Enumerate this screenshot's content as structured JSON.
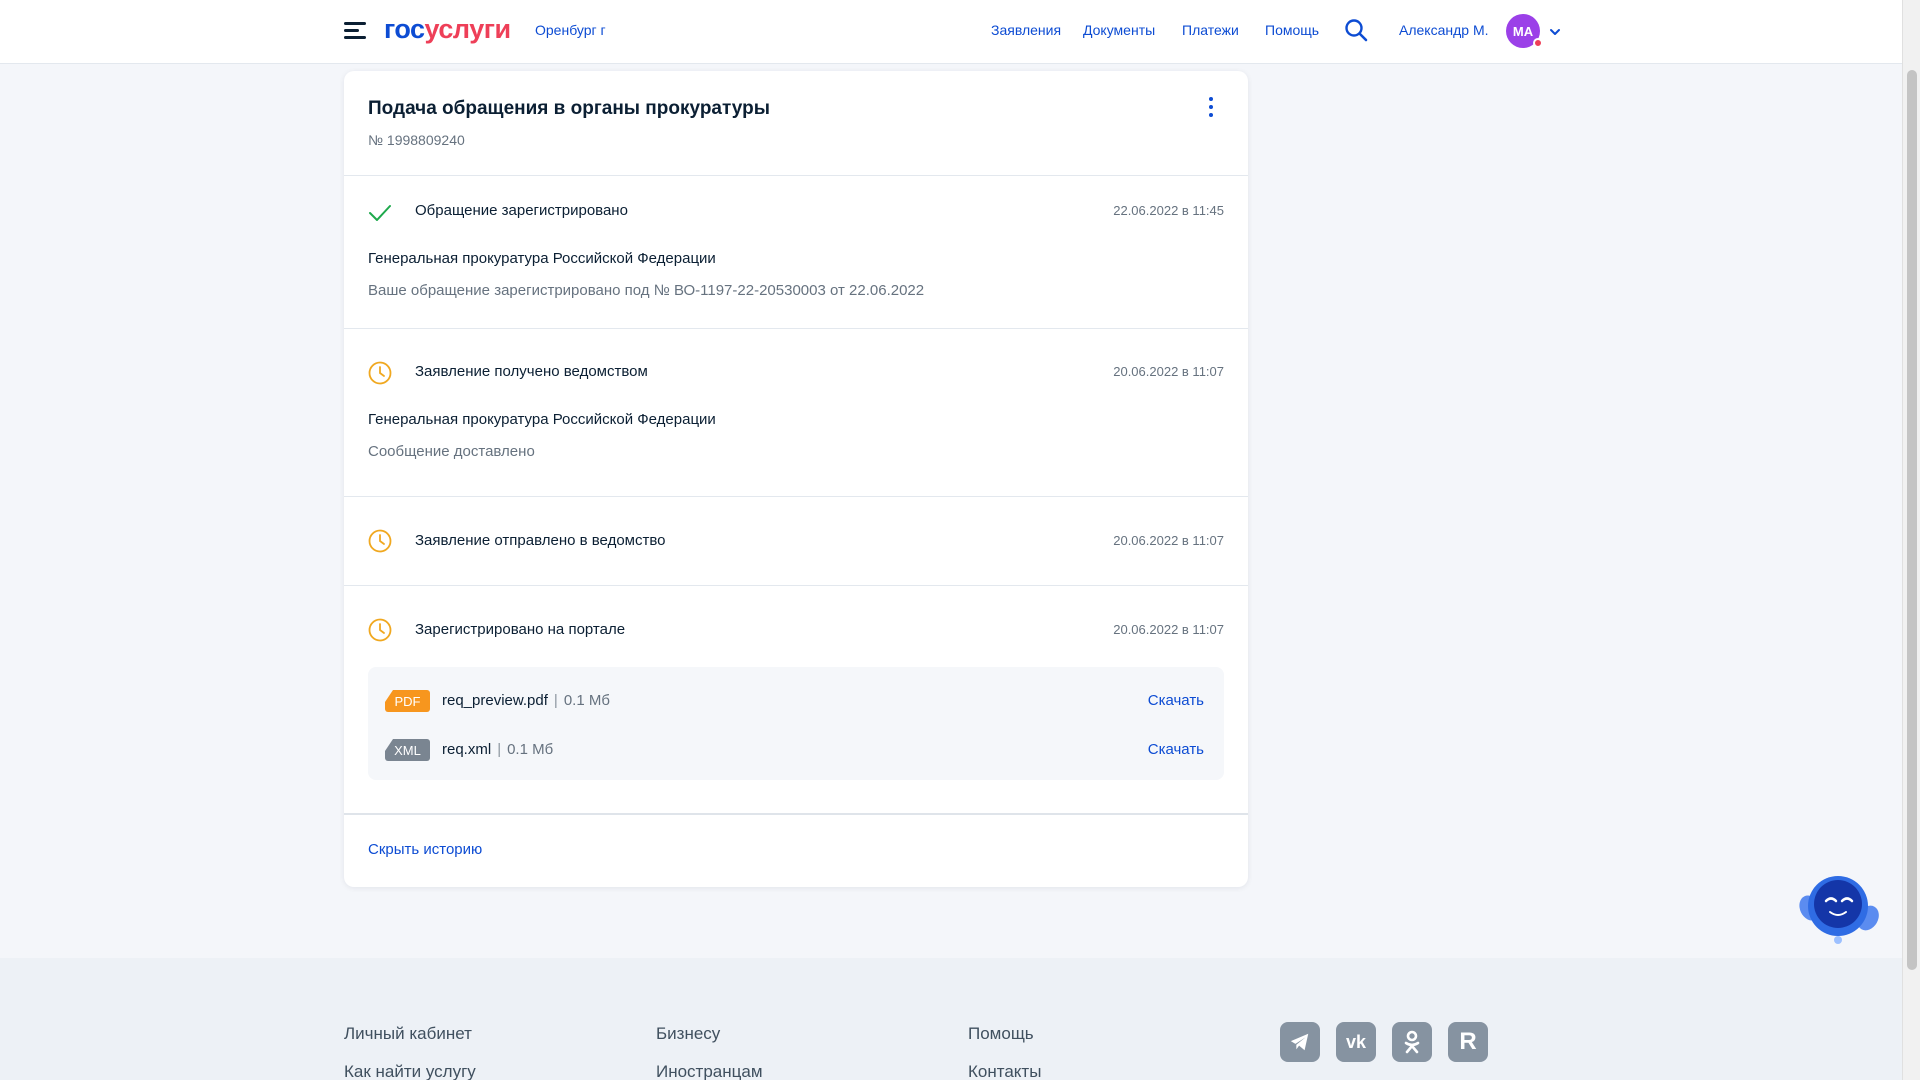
{
  "header": {
    "logo_part1": "гос",
    "logo_part2": "услуги",
    "city": "Оренбург г",
    "nav": [
      "Заявления",
      "Документы",
      "Платежи",
      "Помощь"
    ],
    "user_name": "Александр М.",
    "avatar_initials": "МА"
  },
  "request": {
    "title": "Подача обращения в органы прокуратуры",
    "number": "№ 1998809240",
    "events": [
      {
        "status": "Обращение зарегистрировано",
        "date": "22.06.2022 в 11:45",
        "icon": "check-icon",
        "org": "Генеральная прокуратура Российской Федерации",
        "message": "Ваше обращение зарегистрировано под № ВО-1197-22-20530003 от 22.06.2022"
      },
      {
        "status": "Заявление получено ведомством",
        "date": "20.06.2022 в 11:07",
        "icon": "clock-icon",
        "org": "Генеральная прокуратура Российской Федерации",
        "message": "Сообщение доставлено"
      },
      {
        "status": "Заявление отправлено в ведомство",
        "date": "20.06.2022 в 11:07",
        "icon": "clock-icon"
      },
      {
        "status": "Зарегистрировано на портале",
        "date": "20.06.2022 в 11:07",
        "icon": "clock-icon"
      }
    ],
    "files": [
      {
        "type": "PDF",
        "name": "req_preview.pdf",
        "size": "0.1 Мб",
        "download": "Скачать",
        "color": "#f7961e"
      },
      {
        "type": "XML",
        "name": "req.xml",
        "size": "0.1 Мб",
        "download": "Скачать",
        "color": "#7a8591"
      }
    ],
    "hide_history": "Скрыть историю"
  },
  "footer": {
    "links": [
      "Личный кабинет",
      "Как найти услугу",
      "Бизнесу",
      "Иностранцам",
      "Помощь",
      "Контакты"
    ],
    "social": [
      "telegram-icon",
      "vk-icon",
      "odnoklassniki-icon",
      "rutube-icon"
    ]
  },
  "colors": {
    "accent": "#0d4cd3",
    "brand_red": "#ee3f58",
    "success": "#1ea94c",
    "pending": "#f0a820"
  }
}
